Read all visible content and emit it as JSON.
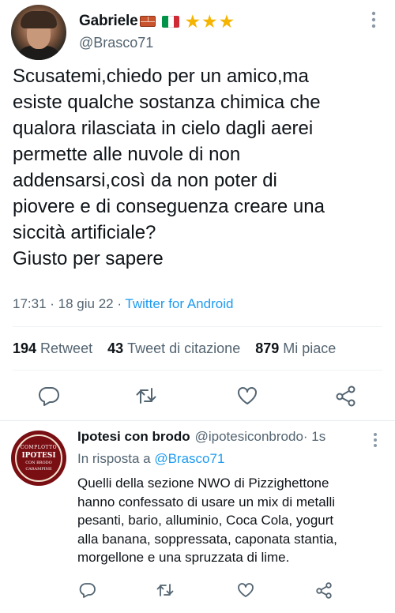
{
  "main_tweet": {
    "author": {
      "display_name": "Gabriele",
      "emoji_icons": [
        "brick-icon",
        "italy-flag-icon"
      ],
      "stars": "★★★",
      "handle": "@Brasco71"
    },
    "text": "Scusatemi,chiedo per un amico,ma\nesiste qualche sostanza chimica che\nqualora rilasciata in cielo dagli aerei\npermette alle nuvole di non\naddensarsi,così da non poter di\npiovere e di conseguenza creare una\nsiccità artificiale?\nGiusto per sapere",
    "time": "17:31",
    "dot1": " · ",
    "date": "18 giu 22",
    "dot2": " · ",
    "source": "Twitter for Android",
    "stats": [
      {
        "count": "194",
        "label": "Retweet"
      },
      {
        "count": "43",
        "label": "Tweet di citazione"
      },
      {
        "count": "879",
        "label": "Mi piace"
      }
    ],
    "actions": [
      "reply-icon",
      "retweet-icon",
      "like-icon",
      "share-icon"
    ]
  },
  "reply": {
    "avatar_text": [
      "COMPLOTTO",
      "IPOTESI",
      "CON BRODO",
      "CARAMPINE"
    ],
    "display_name": "Ipotesi con brodo",
    "handle": "@ipotesiconbrodo",
    "time": " · 1s",
    "reply_prefix": "In risposta a ",
    "reply_to": "@Brasco71",
    "text": "Quelli della sezione NWO di Pizzighettone\nhanno confessato di usare un mix di metalli\npesanti, bario, alluminio, Coca Cola, yogurt\nalla banana, soppressata, caponata stantia,\nmorgellone e una spruzzata di lime.",
    "actions": [
      "reply-icon",
      "retweet-icon",
      "like-icon",
      "share-icon"
    ]
  },
  "colors": {
    "accent": "#1d9bf0",
    "secondary_text": "#536471",
    "star": "#f5b400"
  }
}
